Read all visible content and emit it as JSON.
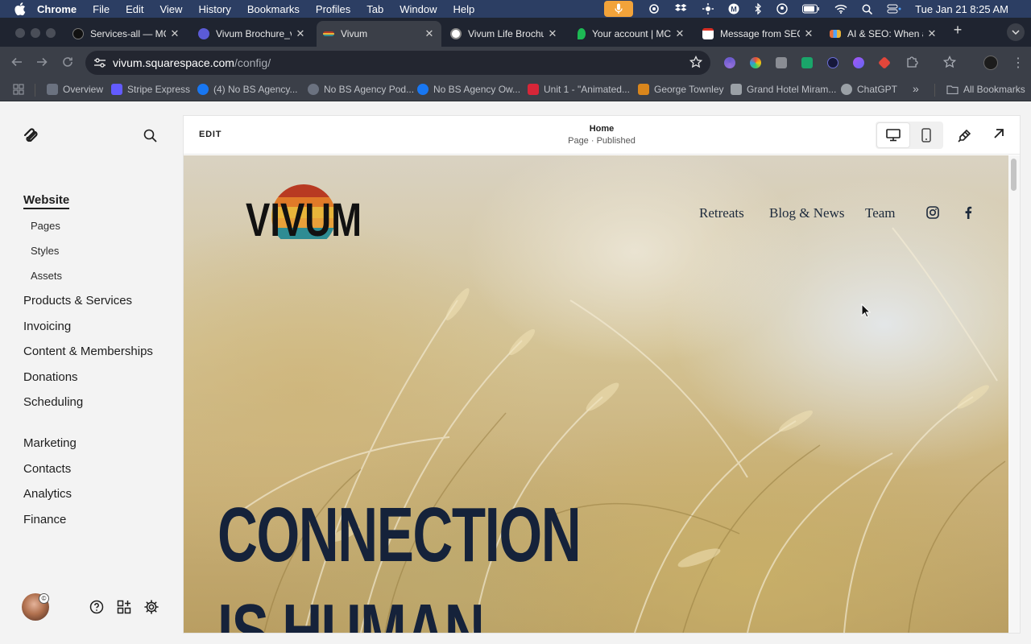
{
  "menubar": {
    "app": "Chrome",
    "items": [
      "File",
      "Edit",
      "View",
      "History",
      "Bookmarks",
      "Profiles",
      "Tab",
      "Window",
      "Help"
    ],
    "clock": "Tue Jan 21  8:25 AM"
  },
  "tabs": [
    {
      "title": "Services-all — MC",
      "color": "#111111"
    },
    {
      "title": "Vivum Brochure_v",
      "color": "#5b5bd6"
    },
    {
      "title": "Vivum",
      "color": "#111111"
    },
    {
      "title": "Vivum Life Brochu",
      "color": "#e8e8e8"
    },
    {
      "title": "Your account | MC",
      "color": "#1db954"
    },
    {
      "title": "Message from SEO",
      "color": "#d93025"
    },
    {
      "title": "AI & SEO: When a",
      "color": "#e8703a"
    }
  ],
  "omnibox": {
    "host": "vivum.squarespace.com",
    "path": "/config/"
  },
  "bookmarks": [
    {
      "label": "Overview",
      "color": "#6b7280"
    },
    {
      "label": "Stripe Express",
      "color": "#635bff"
    },
    {
      "label": "(4) No BS Agency...",
      "color": "#1877f2"
    },
    {
      "label": "No BS Agency Pod...",
      "color": "#6b7280"
    },
    {
      "label": "No BS Agency Ow...",
      "color": "#1877f2"
    },
    {
      "label": "Unit 1 - \"Animated...",
      "color": "#d72638"
    },
    {
      "label": "George Townley",
      "color": "#d9861c"
    },
    {
      "label": "Grand Hotel Miram...",
      "color": "#9aa0a6"
    },
    {
      "label": "ChatGPT",
      "color": "#9aa0a6"
    }
  ],
  "bookmarks_more": "»",
  "all_bookmarks": "All Bookmarks",
  "sidebar": {
    "primary_top": "Website",
    "sub": [
      "Pages",
      "Styles",
      "Assets"
    ],
    "primary": [
      "Products & Services",
      "Invoicing",
      "Content & Memberships",
      "Donations",
      "Scheduling"
    ],
    "secondary": [
      "Marketing",
      "Contacts",
      "Analytics",
      "Finance"
    ]
  },
  "editor": {
    "edit_label": "EDIT",
    "page_name": "Home",
    "page_status": "Page · Published"
  },
  "site": {
    "logo_text": "VIVUM",
    "nav": [
      "Retreats",
      "Blog & News",
      "Team"
    ],
    "hero_line1": "CONNECTION",
    "hero_line2": "IS HUMAN",
    "colors": {
      "navy": "#15223a",
      "sun_red": "#b83a22",
      "sun_orange": "#e07a28",
      "sun_gold": "#e8b53a",
      "sun_teal": "#2e8c93"
    }
  }
}
